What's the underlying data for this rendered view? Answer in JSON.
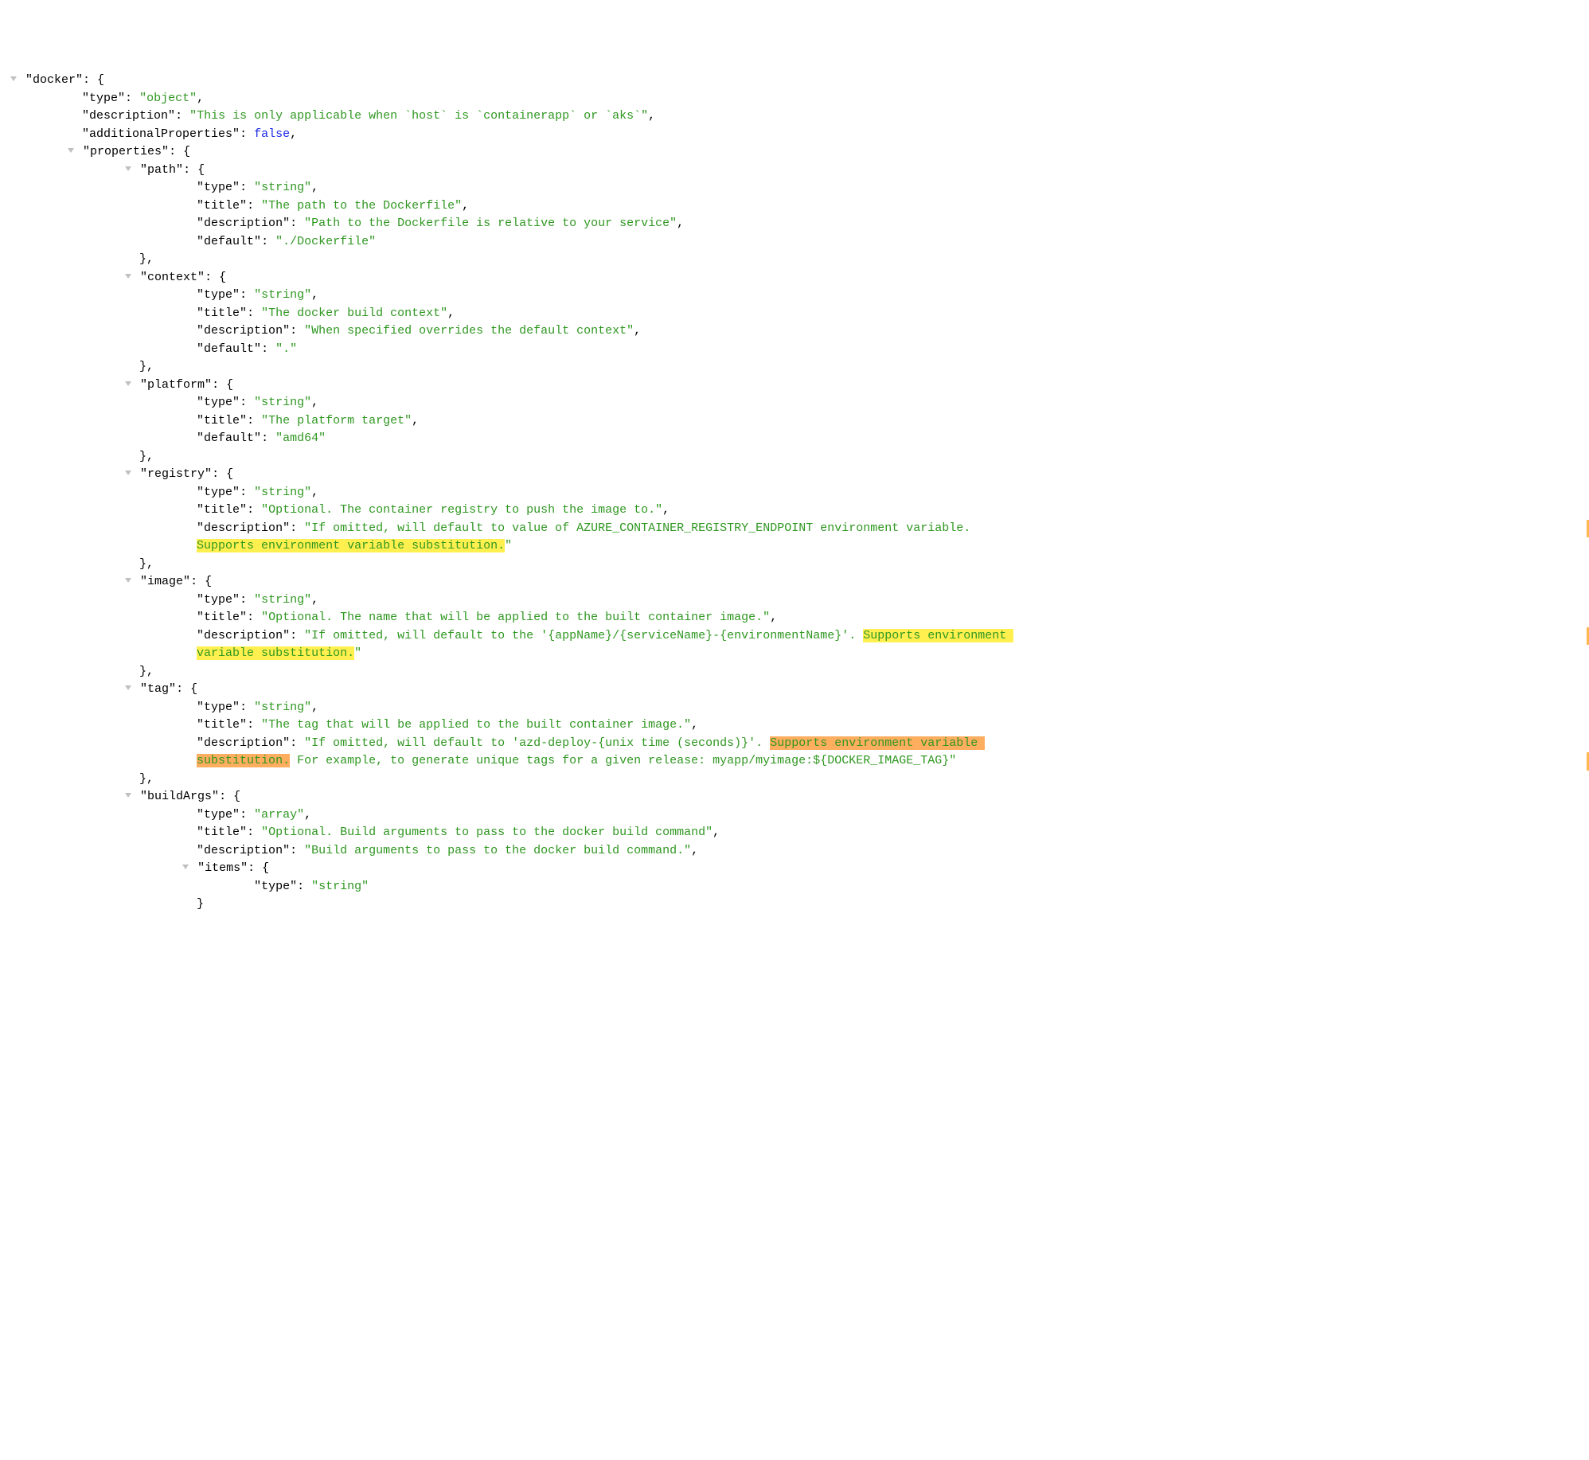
{
  "indentUnit": "    ",
  "lines": [
    {
      "depth": 0,
      "arrow": true,
      "segs": [
        {
          "t": "\"docker\"",
          "c": "key"
        },
        {
          "t": ": {",
          "c": "punc"
        }
      ]
    },
    {
      "depth": 1,
      "segs": [
        {
          "t": "\"type\"",
          "c": "key"
        },
        {
          "t": ": ",
          "c": "punc"
        },
        {
          "t": "\"object\"",
          "c": "str"
        },
        {
          "t": ",",
          "c": "punc"
        }
      ]
    },
    {
      "depth": 1,
      "segs": [
        {
          "t": "\"description\"",
          "c": "key"
        },
        {
          "t": ": ",
          "c": "punc"
        },
        {
          "t": "\"This is only applicable when `host` is `containerapp` or `aks`\"",
          "c": "str"
        },
        {
          "t": ",",
          "c": "punc"
        }
      ]
    },
    {
      "depth": 1,
      "segs": [
        {
          "t": "\"additionalProperties\"",
          "c": "key"
        },
        {
          "t": ": ",
          "c": "punc"
        },
        {
          "t": "false",
          "c": "kw"
        },
        {
          "t": ",",
          "c": "punc"
        }
      ]
    },
    {
      "depth": 1,
      "arrow": true,
      "segs": [
        {
          "t": "\"properties\"",
          "c": "key"
        },
        {
          "t": ": {",
          "c": "punc"
        }
      ]
    },
    {
      "depth": 2,
      "arrow": true,
      "segs": [
        {
          "t": "\"path\"",
          "c": "key"
        },
        {
          "t": ": {",
          "c": "punc"
        }
      ]
    },
    {
      "depth": 3,
      "segs": [
        {
          "t": "\"type\"",
          "c": "key"
        },
        {
          "t": ": ",
          "c": "punc"
        },
        {
          "t": "\"string\"",
          "c": "str"
        },
        {
          "t": ",",
          "c": "punc"
        }
      ]
    },
    {
      "depth": 3,
      "segs": [
        {
          "t": "\"title\"",
          "c": "key"
        },
        {
          "t": ": ",
          "c": "punc"
        },
        {
          "t": "\"The path to the Dockerfile\"",
          "c": "str"
        },
        {
          "t": ",",
          "c": "punc"
        }
      ]
    },
    {
      "depth": 3,
      "segs": [
        {
          "t": "\"description\"",
          "c": "key"
        },
        {
          "t": ": ",
          "c": "punc"
        },
        {
          "t": "\"Path to the Dockerfile is relative to your service\"",
          "c": "str"
        },
        {
          "t": ",",
          "c": "punc"
        }
      ]
    },
    {
      "depth": 3,
      "segs": [
        {
          "t": "\"default\"",
          "c": "key"
        },
        {
          "t": ": ",
          "c": "punc"
        },
        {
          "t": "\"./Dockerfile\"",
          "c": "str"
        }
      ]
    },
    {
      "depth": 2,
      "segs": [
        {
          "t": "},",
          "c": "punc"
        }
      ]
    },
    {
      "depth": 2,
      "arrow": true,
      "segs": [
        {
          "t": "\"context\"",
          "c": "key"
        },
        {
          "t": ": {",
          "c": "punc"
        }
      ]
    },
    {
      "depth": 3,
      "segs": [
        {
          "t": "\"type\"",
          "c": "key"
        },
        {
          "t": ": ",
          "c": "punc"
        },
        {
          "t": "\"string\"",
          "c": "str"
        },
        {
          "t": ",",
          "c": "punc"
        }
      ]
    },
    {
      "depth": 3,
      "segs": [
        {
          "t": "\"title\"",
          "c": "key"
        },
        {
          "t": ": ",
          "c": "punc"
        },
        {
          "t": "\"The docker build context\"",
          "c": "str"
        },
        {
          "t": ",",
          "c": "punc"
        }
      ]
    },
    {
      "depth": 3,
      "segs": [
        {
          "t": "\"description\"",
          "c": "key"
        },
        {
          "t": ": ",
          "c": "punc"
        },
        {
          "t": "\"When specified overrides the default context\"",
          "c": "str"
        },
        {
          "t": ",",
          "c": "punc"
        }
      ]
    },
    {
      "depth": 3,
      "segs": [
        {
          "t": "\"default\"",
          "c": "key"
        },
        {
          "t": ": ",
          "c": "punc"
        },
        {
          "t": "\".\"",
          "c": "str"
        }
      ]
    },
    {
      "depth": 2,
      "segs": [
        {
          "t": "},",
          "c": "punc"
        }
      ]
    },
    {
      "depth": 2,
      "arrow": true,
      "segs": [
        {
          "t": "\"platform\"",
          "c": "key"
        },
        {
          "t": ": {",
          "c": "punc"
        }
      ]
    },
    {
      "depth": 3,
      "segs": [
        {
          "t": "\"type\"",
          "c": "key"
        },
        {
          "t": ": ",
          "c": "punc"
        },
        {
          "t": "\"string\"",
          "c": "str"
        },
        {
          "t": ",",
          "c": "punc"
        }
      ]
    },
    {
      "depth": 3,
      "segs": [
        {
          "t": "\"title\"",
          "c": "key"
        },
        {
          "t": ": ",
          "c": "punc"
        },
        {
          "t": "\"The platform target\"",
          "c": "str"
        },
        {
          "t": ",",
          "c": "punc"
        }
      ]
    },
    {
      "depth": 3,
      "segs": [
        {
          "t": "\"default\"",
          "c": "key"
        },
        {
          "t": ": ",
          "c": "punc"
        },
        {
          "t": "\"amd64\"",
          "c": "str"
        }
      ]
    },
    {
      "depth": 2,
      "segs": [
        {
          "t": "},",
          "c": "punc"
        }
      ]
    },
    {
      "depth": 2,
      "arrow": true,
      "segs": [
        {
          "t": "\"registry\"",
          "c": "key"
        },
        {
          "t": ": {",
          "c": "punc"
        }
      ]
    },
    {
      "depth": 3,
      "segs": [
        {
          "t": "\"type\"",
          "c": "key"
        },
        {
          "t": ": ",
          "c": "punc"
        },
        {
          "t": "\"string\"",
          "c": "str"
        },
        {
          "t": ",",
          "c": "punc"
        }
      ]
    },
    {
      "depth": 3,
      "segs": [
        {
          "t": "\"title\"",
          "c": "key"
        },
        {
          "t": ": ",
          "c": "punc"
        },
        {
          "t": "\"Optional. The container registry to push the image to.\"",
          "c": "str"
        },
        {
          "t": ",",
          "c": "punc"
        }
      ]
    },
    {
      "depth": 3,
      "segs": [
        {
          "t": "\"description\"",
          "c": "key"
        },
        {
          "t": ": ",
          "c": "punc"
        },
        {
          "t": "\"If omitted, will default to value of AZURE_CONTAINER_REGISTRY_ENDPOINT environment variable. ",
          "c": "str"
        }
      ],
      "marker": true
    },
    {
      "depth": 3,
      "segs": [
        {
          "t": "Supports environment variable substitution.",
          "c": "str",
          "hl": "Y"
        },
        {
          "t": "\"",
          "c": "str"
        }
      ]
    },
    {
      "depth": 2,
      "segs": [
        {
          "t": "},",
          "c": "punc"
        }
      ]
    },
    {
      "depth": 2,
      "arrow": true,
      "segs": [
        {
          "t": "\"image\"",
          "c": "key"
        },
        {
          "t": ": {",
          "c": "punc"
        }
      ]
    },
    {
      "depth": 3,
      "segs": [
        {
          "t": "\"type\"",
          "c": "key"
        },
        {
          "t": ": ",
          "c": "punc"
        },
        {
          "t": "\"string\"",
          "c": "str"
        },
        {
          "t": ",",
          "c": "punc"
        }
      ]
    },
    {
      "depth": 3,
      "segs": [
        {
          "t": "\"title\"",
          "c": "key"
        },
        {
          "t": ": ",
          "c": "punc"
        },
        {
          "t": "\"Optional. The name that will be applied to the built container image.\"",
          "c": "str"
        },
        {
          "t": ",",
          "c": "punc"
        }
      ]
    },
    {
      "depth": 3,
      "segs": [
        {
          "t": "\"description\"",
          "c": "key"
        },
        {
          "t": ": ",
          "c": "punc"
        },
        {
          "t": "\"If omitted, will default to the '{appName}/{serviceName}-{environmentName}'. ",
          "c": "str"
        },
        {
          "t": "Supports environment ",
          "c": "str",
          "hl": "Y"
        }
      ],
      "marker": true
    },
    {
      "depth": 3,
      "segs": [
        {
          "t": "variable substitution.",
          "c": "str",
          "hl": "Y"
        },
        {
          "t": "\"",
          "c": "str"
        }
      ]
    },
    {
      "depth": 2,
      "segs": [
        {
          "t": "},",
          "c": "punc"
        }
      ]
    },
    {
      "depth": 2,
      "arrow": true,
      "segs": [
        {
          "t": "\"tag\"",
          "c": "key"
        },
        {
          "t": ": {",
          "c": "punc"
        }
      ]
    },
    {
      "depth": 3,
      "segs": [
        {
          "t": "\"type\"",
          "c": "key"
        },
        {
          "t": ": ",
          "c": "punc"
        },
        {
          "t": "\"string\"",
          "c": "str"
        },
        {
          "t": ",",
          "c": "punc"
        }
      ]
    },
    {
      "depth": 3,
      "segs": [
        {
          "t": "\"title\"",
          "c": "key"
        },
        {
          "t": ": ",
          "c": "punc"
        },
        {
          "t": "\"The tag that will be applied to the built container image.\"",
          "c": "str"
        },
        {
          "t": ",",
          "c": "punc"
        }
      ]
    },
    {
      "depth": 3,
      "segs": [
        {
          "t": "\"description\"",
          "c": "key"
        },
        {
          "t": ": ",
          "c": "punc"
        },
        {
          "t": "\"If omitted, will default to 'azd-deploy-{unix time (seconds)}'. ",
          "c": "str"
        },
        {
          "t": "Supports environment variable ",
          "c": "str",
          "hl": "O"
        }
      ]
    },
    {
      "depth": 3,
      "segs": [
        {
          "t": "substitution.",
          "c": "str",
          "hl": "O"
        },
        {
          "t": " For example, to generate unique tags for a given release: myapp/myimage:${DOCKER_IMAGE_TAG}\"",
          "c": "str"
        }
      ],
      "marker": true
    },
    {
      "depth": 2,
      "segs": [
        {
          "t": "},",
          "c": "punc"
        }
      ]
    },
    {
      "depth": 2,
      "arrow": true,
      "segs": [
        {
          "t": "\"buildArgs\"",
          "c": "key"
        },
        {
          "t": ": {",
          "c": "punc"
        }
      ]
    },
    {
      "depth": 3,
      "segs": [
        {
          "t": "\"type\"",
          "c": "key"
        },
        {
          "t": ": ",
          "c": "punc"
        },
        {
          "t": "\"array\"",
          "c": "str"
        },
        {
          "t": ",",
          "c": "punc"
        }
      ]
    },
    {
      "depth": 3,
      "segs": [
        {
          "t": "\"title\"",
          "c": "key"
        },
        {
          "t": ": ",
          "c": "punc"
        },
        {
          "t": "\"Optional. Build arguments to pass to the docker build command\"",
          "c": "str"
        },
        {
          "t": ",",
          "c": "punc"
        }
      ]
    },
    {
      "depth": 3,
      "segs": [
        {
          "t": "\"description\"",
          "c": "key"
        },
        {
          "t": ": ",
          "c": "punc"
        },
        {
          "t": "\"Build arguments to pass to the docker build command.\"",
          "c": "str"
        },
        {
          "t": ",",
          "c": "punc"
        }
      ]
    },
    {
      "depth": 3,
      "arrow": true,
      "segs": [
        {
          "t": "\"items\"",
          "c": "key"
        },
        {
          "t": ": {",
          "c": "punc"
        }
      ]
    },
    {
      "depth": 4,
      "segs": [
        {
          "t": "\"type\"",
          "c": "key"
        },
        {
          "t": ": ",
          "c": "punc"
        },
        {
          "t": "\"string\"",
          "c": "str"
        }
      ]
    },
    {
      "depth": 3,
      "segs": [
        {
          "t": "}",
          "c": "punc"
        }
      ]
    }
  ]
}
